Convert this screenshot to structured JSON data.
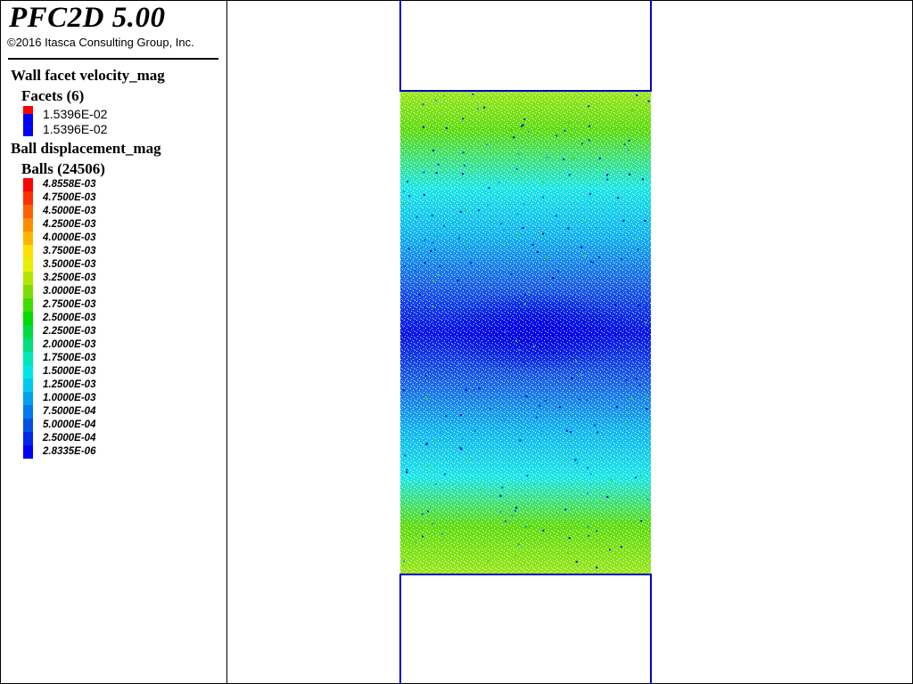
{
  "header": {
    "app_title": "PFC2D 5.00",
    "copyright": "©2016 Itasca Consulting Group, Inc."
  },
  "legend": {
    "wall_title": "Wall facet velocity_mag",
    "facets_title": "Facets (6)",
    "facet_values": [
      {
        "label": "1.5396E-02",
        "color": "#ff0000"
      },
      {
        "label": "1.5396E-02",
        "color": "#0000ff"
      }
    ],
    "ball_title": "Ball displacement_mag",
    "balls_title": "Balls (24506)",
    "ball_scale": [
      {
        "label": "4.8558E-03",
        "color": "#ff0000"
      },
      {
        "label": "4.7500E-03",
        "color": "#ff3000"
      },
      {
        "label": "4.5000E-03",
        "color": "#ff6000"
      },
      {
        "label": "4.2500E-03",
        "color": "#ff8c00"
      },
      {
        "label": "4.0000E-03",
        "color": "#ffb400"
      },
      {
        "label": "3.7500E-03",
        "color": "#ffe000"
      },
      {
        "label": "3.5000E-03",
        "color": "#e6f000"
      },
      {
        "label": "3.2500E-03",
        "color": "#b4e600"
      },
      {
        "label": "3.0000E-03",
        "color": "#80dc00"
      },
      {
        "label": "2.7500E-03",
        "color": "#40dc00"
      },
      {
        "label": "2.5000E-03",
        "color": "#00dc00"
      },
      {
        "label": "2.2500E-03",
        "color": "#00dc40"
      },
      {
        "label": "2.0000E-03",
        "color": "#00dc80"
      },
      {
        "label": "1.7500E-03",
        "color": "#00e6b4"
      },
      {
        "label": "1.5000E-03",
        "color": "#00e6e6"
      },
      {
        "label": "1.2500E-03",
        "color": "#00c8f0"
      },
      {
        "label": "1.0000E-03",
        "color": "#00a0f0"
      },
      {
        "label": "7.5000E-04",
        "color": "#0078f0"
      },
      {
        "label": "5.0000E-04",
        "color": "#0050e6"
      },
      {
        "label": "2.5000E-04",
        "color": "#0028e6"
      },
      {
        "label": "2.8335E-06",
        "color": "#0000ff"
      }
    ]
  },
  "model": {
    "wall_color": "#0000cc",
    "field_colors": {
      "top_edge": "#9be61e",
      "green": "#5fdc14",
      "cyan": "#1ee6e6",
      "light_blue": "#14b4f0",
      "blue": "#1e64e6",
      "deep_blue": "#0a14e6"
    }
  }
}
